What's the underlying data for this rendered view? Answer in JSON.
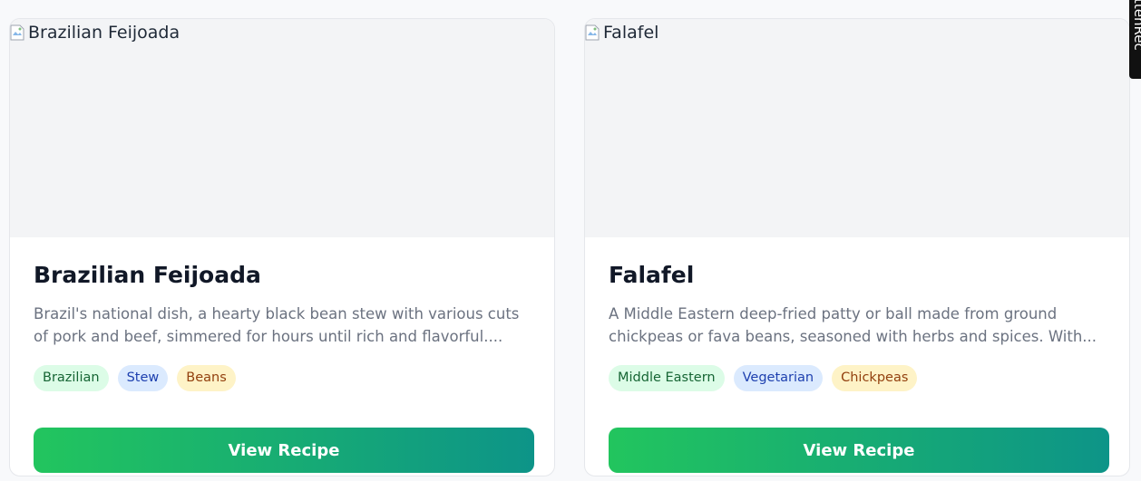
{
  "side_tab": {
    "label": "ttenRec"
  },
  "cards": [
    {
      "image_alt": "Brazilian Feijoada",
      "title": "Brazilian Feijoada",
      "description_lines": [
        "Brazil's national dish, a hearty black bean stew with various cuts",
        "of pork and beef, simmered for hours until rich and flavorful...."
      ],
      "tags": [
        "Brazilian",
        "Stew",
        "Beans"
      ],
      "button_label": "View Recipe"
    },
    {
      "image_alt": "Falafel",
      "title": "Falafel",
      "description_lines": [
        "A Middle Eastern deep-fried patty or ball made from ground",
        "chickpeas or fava beans, seasoned with herbs and spices. With..."
      ],
      "tags": [
        "Middle Eastern",
        "Vegetarian",
        "Chickpeas"
      ],
      "button_label": "View Recipe"
    }
  ],
  "colors": {
    "tag_green_bg": "#dcfce7",
    "tag_blue_bg": "#dbeafe",
    "tag_yellow_bg": "#fef3c7",
    "button_gradient_start": "#22c55e",
    "button_gradient_end": "#0d9488"
  }
}
